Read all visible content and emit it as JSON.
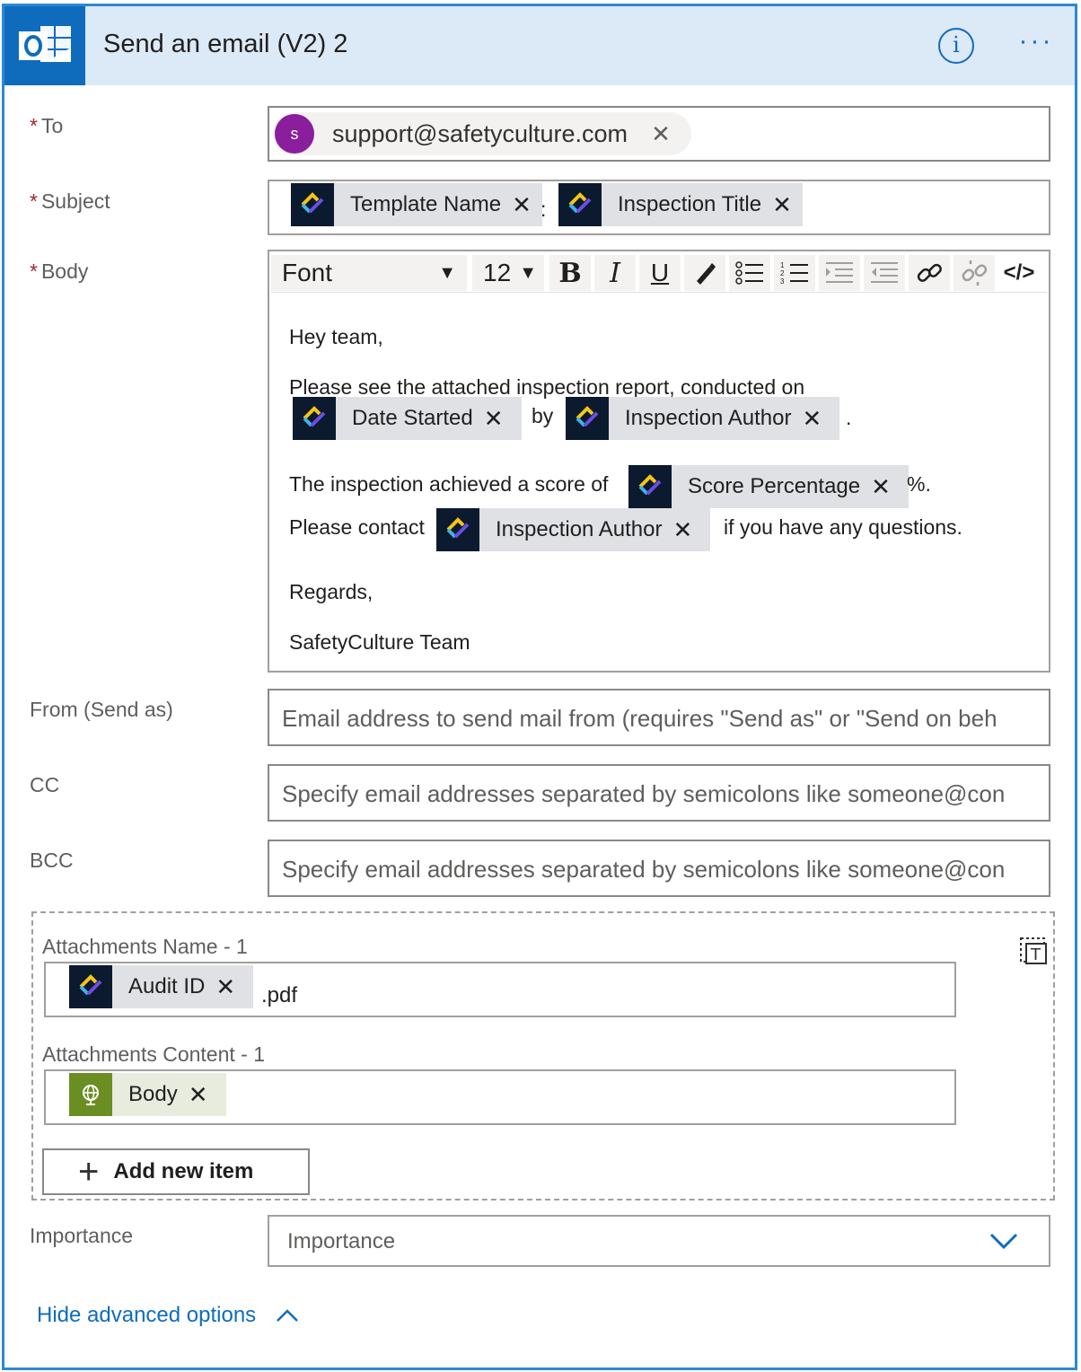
{
  "header": {
    "title": "Send an email (V2) 2",
    "logo_icon": "outlook-icon",
    "info_icon": "info-icon",
    "more_icon": "more-icon"
  },
  "to": {
    "label": "To",
    "required": "*",
    "avatar_letter": "s",
    "recipient": "support@safetyculture.com",
    "remove_glyph": "✕"
  },
  "subject": {
    "label": "Subject",
    "required": "*",
    "tokens": [
      {
        "label": "Template Name",
        "remove": "✕"
      },
      {
        "label": "Inspection Title",
        "remove": "✕"
      }
    ],
    "separator": ":"
  },
  "body": {
    "label": "Body",
    "required": "*",
    "toolbar": {
      "font": "Font",
      "size": "12",
      "bold": "B",
      "italic": "I",
      "underline": "U",
      "dropdown_glyph": "▼",
      "code": "</>"
    },
    "lines": {
      "greeting": "Hey team,",
      "para1": "Please see the attached inspection report, conducted on",
      "token_date": "Date Started",
      "by": "by",
      "token_author1": "Inspection Author",
      "period": ".",
      "score_text": "The inspection achieved a score of",
      "token_score": "Score Percentage",
      "percent": "%.",
      "contact_text": "Please contact",
      "token_author2": "Inspection Author",
      "questions": "if you have any questions.",
      "regards": "Regards,",
      "signature": "SafetyCulture Team"
    },
    "remove": "✕"
  },
  "from": {
    "label": "From (Send as)",
    "placeholder": "Email address to send mail from (requires \"Send as\" or \"Send on beh"
  },
  "cc": {
    "label": "CC",
    "placeholder": "Specify email addresses separated by semicolons like someone@con"
  },
  "bcc": {
    "label": "BCC",
    "placeholder": "Specify email addresses separated by semicolons like someone@con"
  },
  "attachments": {
    "name_label": "Attachments Name - 1",
    "name_token": "Audit ID",
    "name_suffix": ".pdf",
    "content_label": "Attachments Content - 1",
    "content_token": "Body",
    "remove": "✕",
    "add_label": "Add new item",
    "add_glyph": "+"
  },
  "importance": {
    "label": "Importance",
    "value": "Importance"
  },
  "advanced": {
    "label": "Hide advanced options"
  },
  "colors": {
    "accent": "#0f6cbd",
    "header_bg": "#dce9f7",
    "chip_bg": "#dfe1e5",
    "required": "#a4262c"
  }
}
